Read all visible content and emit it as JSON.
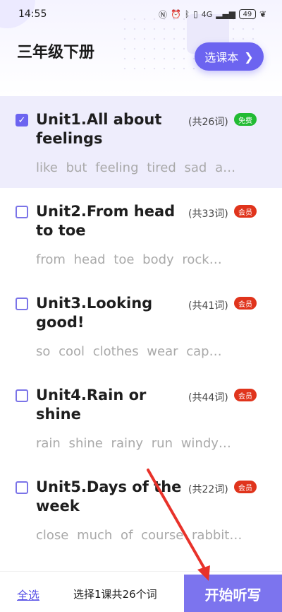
{
  "status_bar": {
    "time": "14:55",
    "network": "4G",
    "battery": "49"
  },
  "header": {
    "title": "三年级下册",
    "choose_book_label": "选课本"
  },
  "units": [
    {
      "title": "Unit1.All about feelings",
      "count": "(共26词)",
      "badge": "免费",
      "badge_type": "free",
      "words": "like  but  feeling  tired  sad  a…",
      "selected": true
    },
    {
      "title": "Unit2.From head to toe",
      "count": "(共33词)",
      "badge": "会员",
      "badge_type": "member",
      "words": "from  head  toe  body  rock…",
      "selected": false
    },
    {
      "title": "Unit3.Looking good!",
      "count": "(共41词)",
      "badge": "会员",
      "badge_type": "member",
      "words": "so  cool  clothes  wear  cap…",
      "selected": false
    },
    {
      "title": "Unit4.Rain or shine",
      "count": "(共44词)",
      "badge": "会员",
      "badge_type": "member",
      "words": "rain  shine  rainy  run  windy…",
      "selected": false
    },
    {
      "title": "Unit5.Days of the week",
      "count": "(共22词)",
      "badge": "会员",
      "badge_type": "member",
      "words": "close  much  of course  rabbit…",
      "selected": false
    }
  ],
  "bottom_bar": {
    "select_all_label": "全选",
    "summary": "选择1课共26个词",
    "start_label": "开始听写"
  },
  "colors": {
    "accent": "#6c64f0",
    "free_badge": "#22bb33",
    "member_badge": "#e0341c",
    "annotation_arrow": "#e8322a"
  }
}
